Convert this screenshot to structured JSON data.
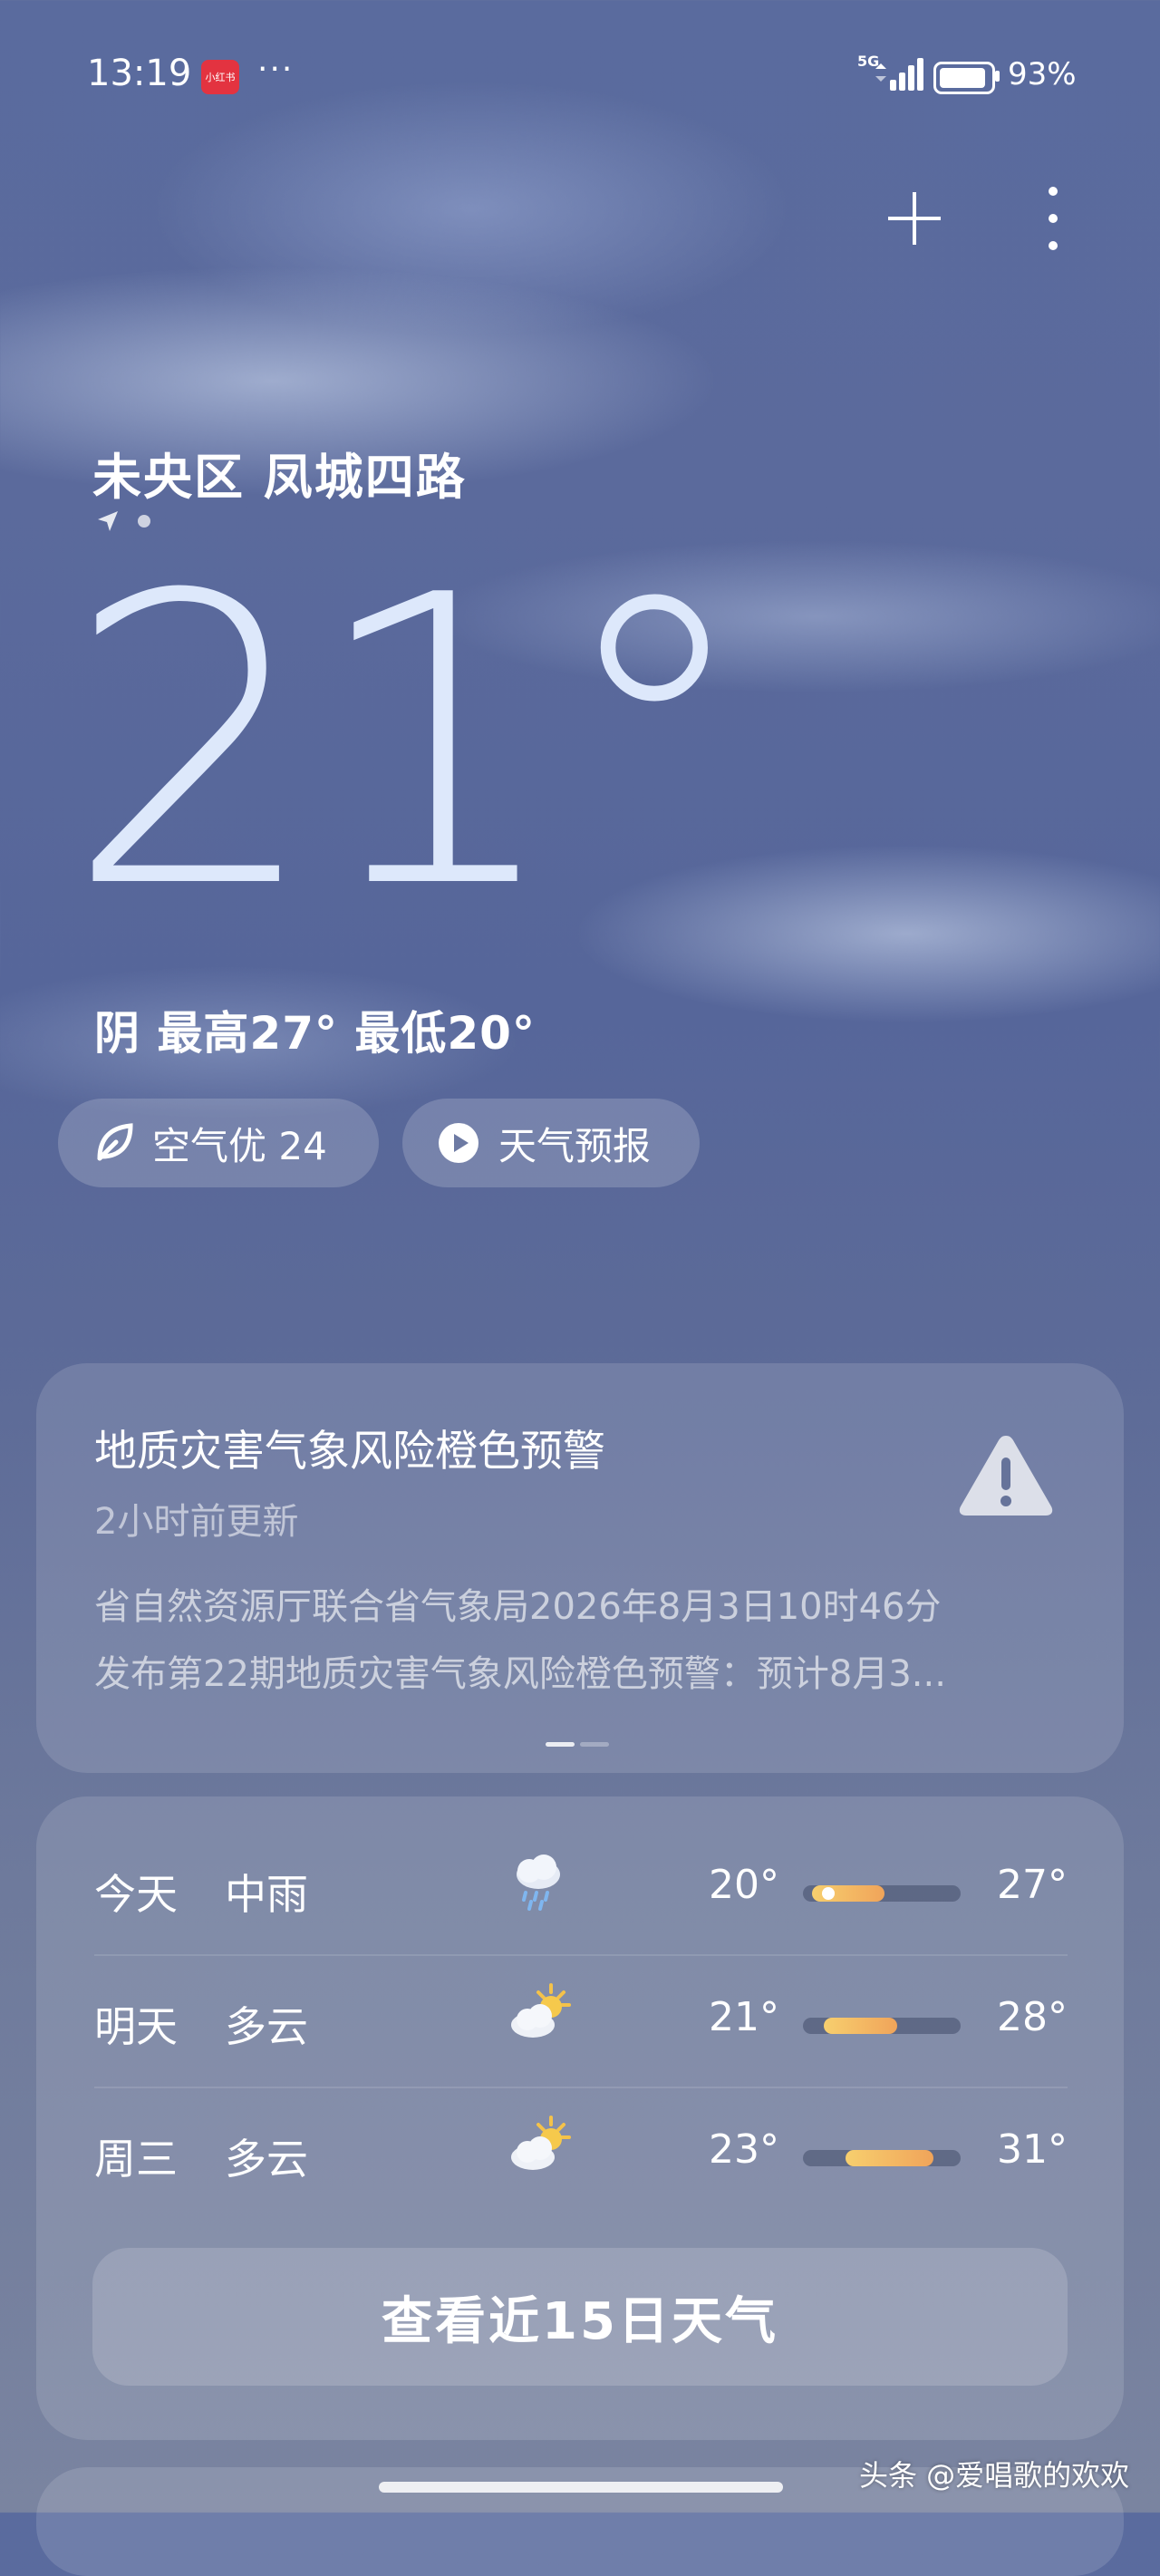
{
  "status_bar": {
    "time": "13:19",
    "app_badge": "小红书",
    "more": "···",
    "network": "5G",
    "battery": "93%"
  },
  "top_actions": {
    "add_icon": "plus-icon",
    "more_icon": "more-vertical-icon"
  },
  "location": {
    "name": "未央区 凤城四路",
    "icon": "location-arrow-icon"
  },
  "current": {
    "temperature": "21°",
    "summary": "阴  最高27° 最低20°"
  },
  "pills": {
    "air_quality": "空气优 24",
    "forecast_video": "天气预报"
  },
  "warning": {
    "title": "地质灾害气象风险橙色预警",
    "updated": "2小时前更新",
    "line1": "省自然资源厅联合省气象局2026年8月3日10时46分",
    "line2": "发布第22期地质灾害气象风险橙色预警：预计8月3...",
    "icon": "warning-triangle-icon"
  },
  "daily": [
    {
      "day": "今天",
      "cond": "中雨",
      "icon": "rain-cloud-icon",
      "low": "20°",
      "high": "27°",
      "bar_start": 0.06,
      "bar_end": 0.52,
      "current_marker": 0.16
    },
    {
      "day": "明天",
      "cond": "多云",
      "icon": "partly-cloudy-icon",
      "low": "21°",
      "high": "28°",
      "bar_start": 0.13,
      "bar_end": 0.6
    },
    {
      "day": "周三",
      "cond": "多云",
      "icon": "partly-cloudy-icon",
      "low": "23°",
      "high": "31°",
      "bar_start": 0.27,
      "bar_end": 0.83
    }
  ],
  "forecast15_label": "查看近15日天气",
  "watermark": "头条 @爱唱歌的欢欢",
  "colors": {
    "bar_fill_start": "#f7cf6e",
    "bar_fill_end": "#f0a45a",
    "badge": "#e33340"
  }
}
